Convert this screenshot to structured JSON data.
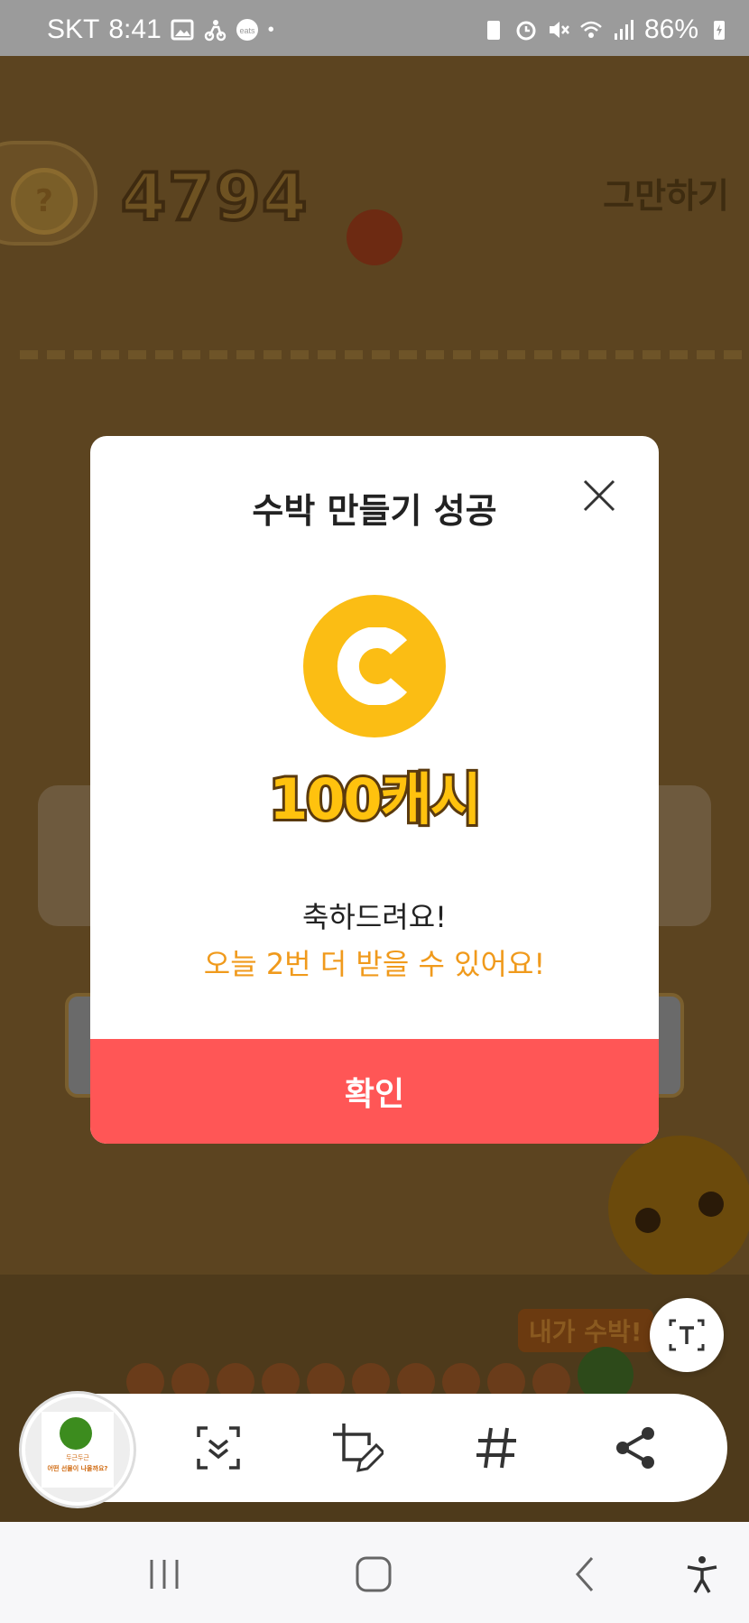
{
  "status_bar": {
    "carrier": "SKT",
    "time": "8:41",
    "icons_left": [
      "gallery-icon",
      "delivery-rider-icon",
      "coupang-eats-icon",
      "dot-icon"
    ],
    "icons_right": [
      "battery-saver-icon",
      "alarm-icon",
      "mute-icon",
      "wifi-icon",
      "signal-icon"
    ],
    "battery": "86%"
  },
  "game": {
    "help_label": "?",
    "score": "4794",
    "quit_label": "그만하기",
    "speech_bubble": "내가 수박!"
  },
  "modal": {
    "title": "수박 만들기 성공",
    "coin_letter": "C",
    "amount": "100캐시",
    "congrats": "축하드려요!",
    "remaining": "오늘 2번 더 받을 수 있어요!",
    "confirm_label": "확인",
    "colors": {
      "coin": "#fbbd14",
      "confirm": "#ff5656",
      "remaining_text": "#f09a1c"
    }
  },
  "screenshot_toolbar": {
    "thumbnail_caption_1": "두근두근",
    "thumbnail_caption_2": "어떤 선물이 나올까요?",
    "buttons": [
      "scroll-capture-icon",
      "crop-edit-icon",
      "hashtag-icon",
      "share-icon"
    ],
    "text_extract": "text-extract-icon"
  },
  "nav_bar": {
    "buttons": [
      "recent-apps-icon",
      "home-icon",
      "back-icon",
      "accessibility-icon"
    ]
  }
}
